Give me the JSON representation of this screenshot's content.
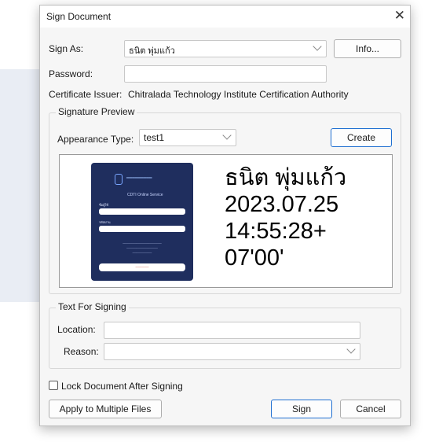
{
  "dialog": {
    "title": "Sign Document",
    "sign_as_label": "Sign As:",
    "sign_as_value": "ธนิต พุ่มแก้ว",
    "info_button": "Info...",
    "password_label": "Password:",
    "password_value": "",
    "cert_issuer_label": "Certificate Issuer:",
    "cert_issuer_value": "Chitralada Technology Institute Certification Authority"
  },
  "signature_preview": {
    "legend": "Signature Preview",
    "appearance_label": "Appearance Type:",
    "appearance_value": "test1",
    "create_button": "Create",
    "card": {
      "label_username": "ชื่อผู้ใช้",
      "label_password": "รหัสผ่าน",
      "service_title": "CDTI Online Service"
    },
    "sig_lines": [
      "ธนิต พุ่มแก้ว",
      "2023.07.25",
      "14:55:28+",
      "07'00'"
    ]
  },
  "text_for_signing": {
    "legend": "Text For Signing",
    "location_label": "Location:",
    "location_value": "",
    "reason_label": "Reason:",
    "reason_value": ""
  },
  "footer": {
    "lock_label": "Lock Document After Signing",
    "lock_checked": false,
    "apply_multiple_button": "Apply to Multiple Files",
    "sign_button": "Sign",
    "cancel_button": "Cancel"
  }
}
